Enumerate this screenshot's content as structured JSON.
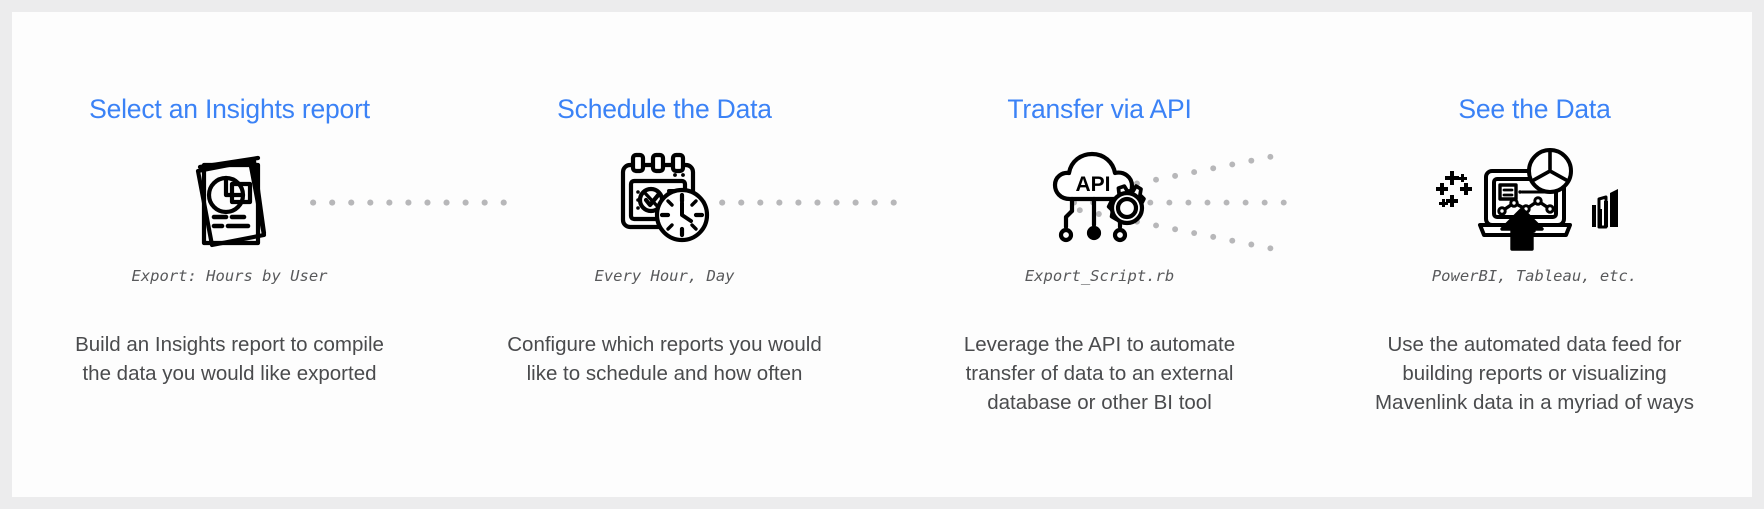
{
  "page": {
    "background_outer": "#ececed",
    "background_inner": "#fdfdfd",
    "accent_color": "#3b82f6",
    "body_text_color": "#4a4b4d",
    "caption_color": "#58595b",
    "dot_color": "#b7b7b9"
  },
  "steps": [
    {
      "title": "Select an Insights report",
      "icon": "stacked-reports-pie-chart-icon",
      "caption": "Export: Hours by User",
      "body": "Build an Insights report to compile the data you would like exported"
    },
    {
      "title": "Schedule the Data",
      "icon": "calendar-check-clock-icon",
      "caption": "Every Hour, Day",
      "body": "Configure which reports you would like to schedule and how often"
    },
    {
      "title": "Transfer via API",
      "icon": "api-cloud-gear-icon",
      "caption": "Export_Script.rb",
      "body": "Leverage the API to automate transfer of data to an external database or other BI tool"
    },
    {
      "title": "See the Data",
      "icon": "bi-dashboard-laptop-icon",
      "caption": "PowerBI, Tableau, etc.",
      "body": "Use the automated data feed for building reports or visualizing Mavenlink data in a myriad of ways"
    }
  ],
  "connectors": [
    {
      "name": "connector-step1-to-step2",
      "style": "dotted-line"
    },
    {
      "name": "connector-step2-to-step3",
      "style": "dotted-line"
    },
    {
      "name": "connector-step3-to-step4",
      "style": "dotted-fan-three-lines"
    }
  ]
}
